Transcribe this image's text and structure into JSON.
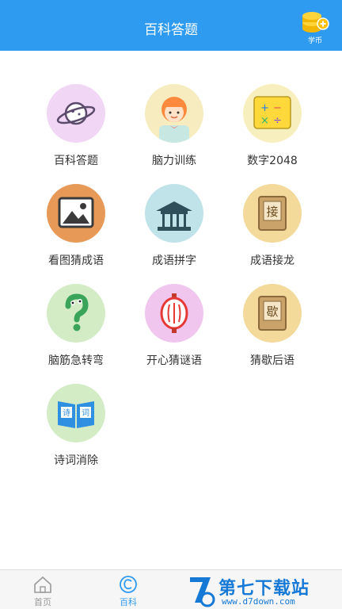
{
  "header": {
    "title": "百科答题",
    "coin_label": "学币"
  },
  "tiles": [
    {
      "label": "百科答题"
    },
    {
      "label": "脑力训练"
    },
    {
      "label": "数字2048"
    },
    {
      "label": "看图猜成语"
    },
    {
      "label": "成语拼字"
    },
    {
      "label": "成语接龙"
    },
    {
      "label": "脑筋急转弯"
    },
    {
      "label": "开心猜谜语"
    },
    {
      "label": "猜歇后语"
    },
    {
      "label": "诗词消除"
    }
  ],
  "tile_icon_text": {
    "jie": "接",
    "xie": "歇",
    "shi": "诗",
    "ci": "词"
  },
  "tabs": [
    {
      "label": "首页"
    },
    {
      "label": "百科"
    },
    {
      "label": ""
    },
    {
      "label": ""
    }
  ],
  "watermark": {
    "main": "第七下载站",
    "sub": "www.d7down.com"
  },
  "colors": {
    "header": "#2f9bf0",
    "active_tab": "#2f9bf0",
    "watermark": "#1679d6"
  }
}
